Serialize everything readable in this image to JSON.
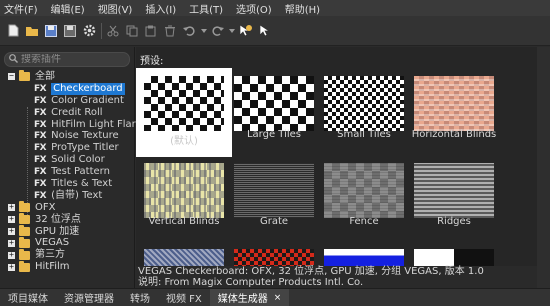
{
  "menu": [
    "文件(F)",
    "编辑(E)",
    "视图(V)",
    "插入(I)",
    "工具(T)",
    "选项(O)",
    "帮助(H)"
  ],
  "toolbar": {
    "icons": [
      "new-file-icon",
      "open-folder-icon",
      "save-icon",
      "save-as-icon",
      "settings-gear-icon",
      "cut-icon",
      "copy-icon",
      "paste-icon",
      "trash-icon",
      "undo-icon",
      "redo-icon",
      "help-pointer-icon",
      "whats-this-icon"
    ]
  },
  "sidebar": {
    "search_placeholder": "搜索插件",
    "root": "全部",
    "fx_tag": "FX",
    "fx_items": [
      "Checkerboard",
      "Color Gradient",
      "Credit Roll",
      "HitFilm Light Flares",
      "Noise Texture",
      "ProType Titler",
      "Solid Color",
      "Test Pattern",
      "Titles & Text",
      "(自带) Text"
    ],
    "folders": [
      "OFX",
      "32 位浮点",
      "GPU 加速",
      "VEGAS",
      "第三方",
      "HitFilm"
    ]
  },
  "main": {
    "presets_label": "预设:",
    "tiles": [
      "(默认)",
      "Large Tiles",
      "Small Tiles",
      "Horizontal Blinds",
      "Vertical Blinds",
      "Grate",
      "Fence",
      "Ridges"
    ]
  },
  "status": {
    "line1": "VEGAS Checkerboard: OFX, 32 位浮点, GPU 加速, 分组 VEGAS, 版本 1.0",
    "line2": "说明: From Magix Computer Products Intl. Co."
  },
  "tabs": [
    "项目媒体",
    "资源管理器",
    "转场",
    "视频 FX",
    "媒体生成器"
  ],
  "tab_close": "×",
  "colors": {
    "selection": "#1e78d2",
    "folder": "#e9b84a",
    "background": "#2b2b2b"
  }
}
